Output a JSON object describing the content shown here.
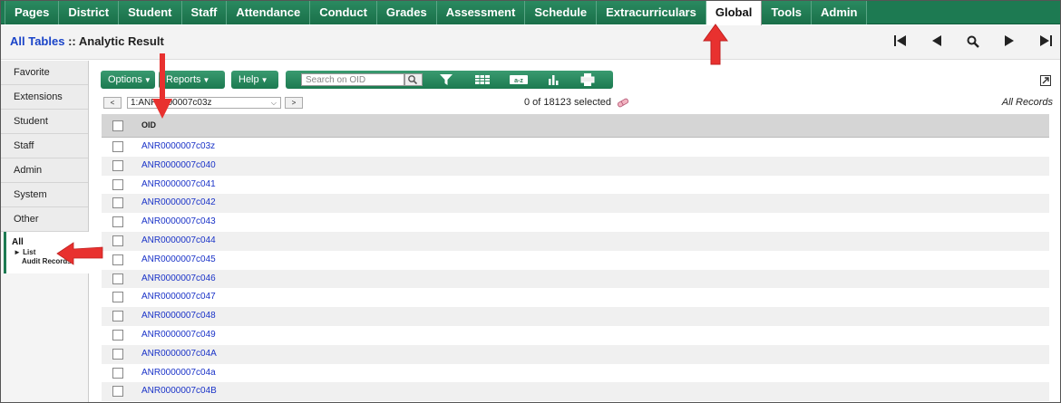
{
  "topnav": {
    "tabs": [
      {
        "label": "Pages",
        "active": false
      },
      {
        "label": "District",
        "active": false
      },
      {
        "label": "Student",
        "active": false
      },
      {
        "label": "Staff",
        "active": false
      },
      {
        "label": "Attendance",
        "active": false
      },
      {
        "label": "Conduct",
        "active": false
      },
      {
        "label": "Grades",
        "active": false
      },
      {
        "label": "Assessment",
        "active": false
      },
      {
        "label": "Schedule",
        "active": false
      },
      {
        "label": "Extracurriculars",
        "active": false
      },
      {
        "label": "Global",
        "active": true
      },
      {
        "label": "Tools",
        "active": false
      },
      {
        "label": "Admin",
        "active": false
      }
    ]
  },
  "titlebar": {
    "crumb": "All Tables",
    "separator": " :: ",
    "page": "Analytic Result"
  },
  "sidebar": {
    "items": [
      "Favorite",
      "Extensions",
      "Student",
      "Staff",
      "Admin",
      "System",
      "Other"
    ],
    "all_label": "All",
    "list_label": "► List",
    "audit_label": "Audit Records"
  },
  "toolbar": {
    "options_label": "Options",
    "reports_label": "Reports",
    "help_label": "Help",
    "search_placeholder": "Search on OID"
  },
  "record_nav": {
    "prev_label": "<",
    "next_label": ">",
    "current_record": "1:ANR0000007c03z",
    "selected_text": "0 of 18123 selected",
    "scope_text": "All Records"
  },
  "table": {
    "column_header": "OID",
    "rows": [
      "ANR0000007c03z",
      "ANR0000007c040",
      "ANR0000007c041",
      "ANR0000007c042",
      "ANR0000007c043",
      "ANR0000007c044",
      "ANR0000007c045",
      "ANR0000007c046",
      "ANR0000007c047",
      "ANR0000007c048",
      "ANR0000007c049",
      "ANR0000007c04A",
      "ANR0000007c04a",
      "ANR0000007c04B"
    ]
  },
  "colors": {
    "nav_green": "#1d7a52",
    "link_blue": "#1a33c8",
    "arrow_red": "#e8312f"
  }
}
